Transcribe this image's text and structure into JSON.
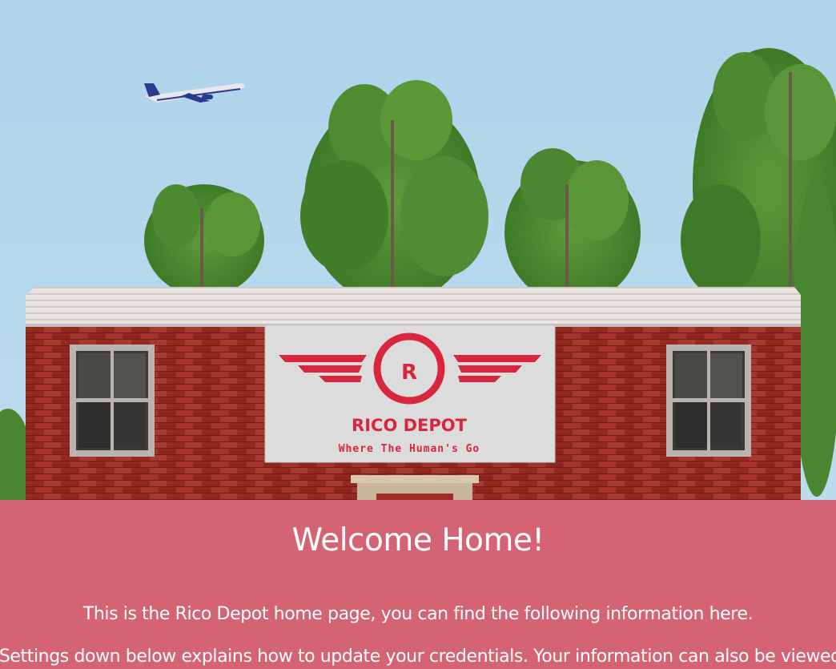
{
  "hero": {
    "sign": {
      "logo_letter": "R",
      "brand_name": "RICO DEPOT",
      "tagline": "Where The Human's Go"
    },
    "colors": {
      "sky": "#b3d6ea",
      "brand_red": "#d9263f",
      "brick": "#9d2d25",
      "sign_bg": "#dcdcdc"
    }
  },
  "welcome": {
    "title": "Welcome Home!",
    "intro": "This is the Rico Depot home page, you can find the following information here.",
    "settings_text": "t Settings down below explains how to update your credentials. Your information can also be viewed",
    "background_color": "#d46374"
  }
}
